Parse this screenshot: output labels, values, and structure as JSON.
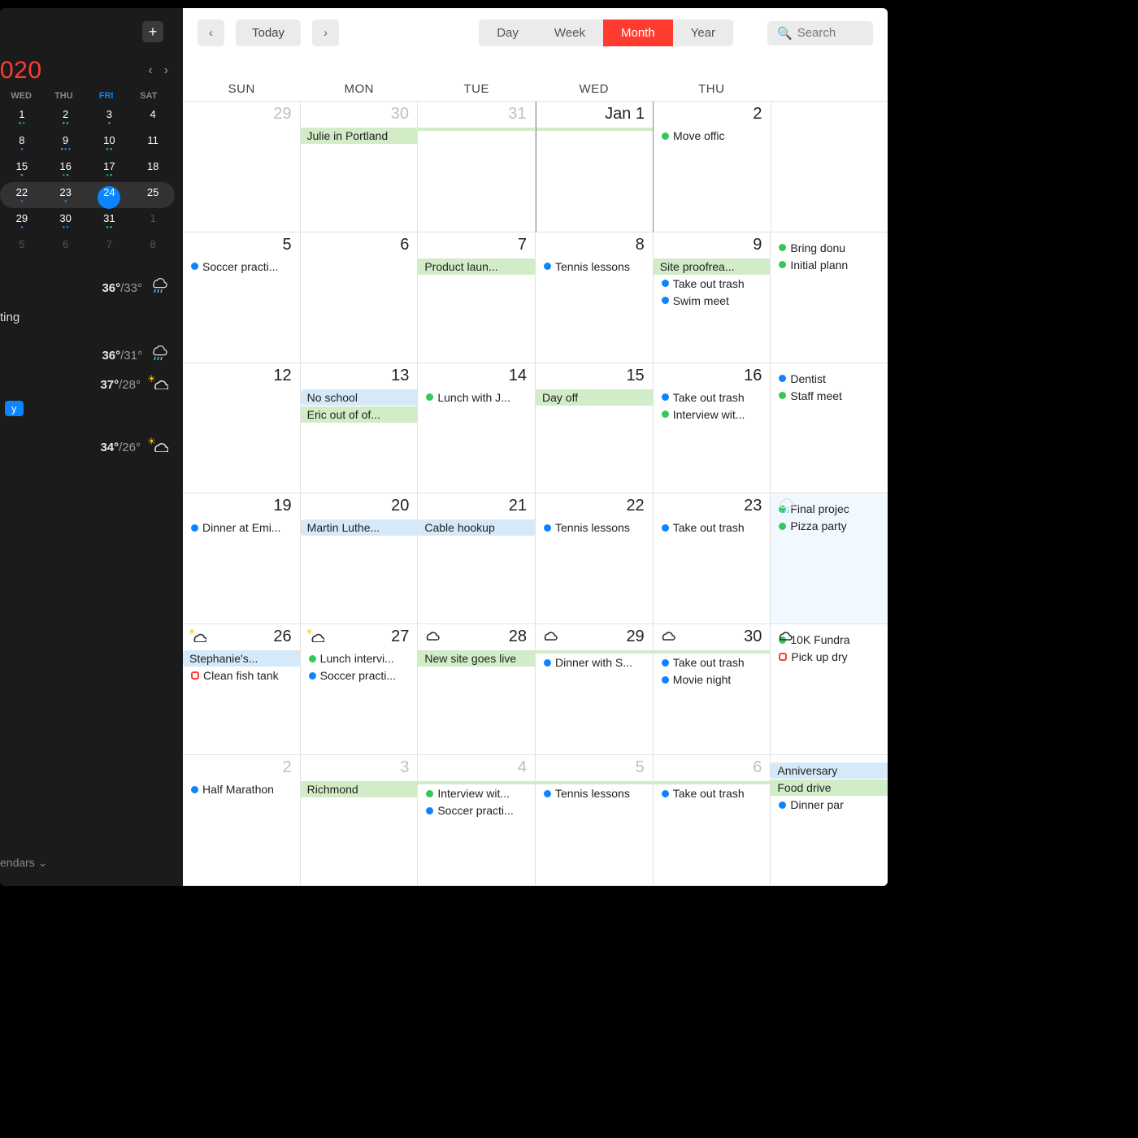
{
  "sidebar": {
    "year": "020",
    "mini_days_head": [
      "WED",
      "THU",
      "FRI",
      "SAT"
    ],
    "mini_grid": [
      [
        {
          "n": "1",
          "dots": [
            "g",
            "b"
          ]
        },
        {
          "n": "2",
          "dots": [
            "g",
            "g"
          ]
        },
        {
          "n": "3",
          "dots": [
            "g"
          ]
        },
        {
          "n": "4",
          "dots": []
        }
      ],
      [
        {
          "n": "8",
          "dots": [
            "b"
          ]
        },
        {
          "n": "9",
          "dots": [
            "g",
            "b",
            "b"
          ]
        },
        {
          "n": "10",
          "dots": [
            "g",
            "g"
          ]
        },
        {
          "n": "11",
          "dots": []
        }
      ],
      [
        {
          "n": "15",
          "dots": [
            "g"
          ]
        },
        {
          "n": "16",
          "dots": [
            "b",
            "g"
          ]
        },
        {
          "n": "17",
          "dots": [
            "b",
            "g"
          ]
        },
        {
          "n": "18",
          "dots": []
        }
      ],
      [
        {
          "n": "22",
          "dots": [
            "b"
          ]
        },
        {
          "n": "23",
          "dots": [
            "b"
          ]
        },
        {
          "n": "24",
          "dots": [
            "b",
            "b"
          ],
          "today": true
        },
        {
          "n": "25",
          "dots": []
        }
      ],
      [
        {
          "n": "29",
          "dots": [
            "b"
          ]
        },
        {
          "n": "30",
          "dots": [
            "b",
            "b"
          ]
        },
        {
          "n": "31",
          "dots": [
            "g",
            "g"
          ]
        },
        {
          "n": "1",
          "dots": [],
          "off": true
        }
      ],
      [
        {
          "n": "5",
          "dots": [],
          "off": true
        },
        {
          "n": "6",
          "dots": [],
          "off": true
        },
        {
          "n": "7",
          "dots": [],
          "off": true
        },
        {
          "n": "8",
          "dots": [],
          "off": true
        }
      ]
    ],
    "today_label": "ting",
    "pill": "y",
    "calendars_label": "endars",
    "weather": [
      {
        "hi": "36°",
        "lo": "/33°",
        "icon": "rain"
      },
      {
        "hi": "36°",
        "lo": "/31°",
        "icon": "rain"
      },
      {
        "hi": "37°",
        "lo": "/28°",
        "icon": "partly"
      },
      {
        "hi": "34°",
        "lo": "/26°",
        "icon": "partly"
      }
    ]
  },
  "toolbar": {
    "today": "Today",
    "views": [
      "Day",
      "Week",
      "Month",
      "Year"
    ],
    "active_view": "Month",
    "search_placeholder": "Search"
  },
  "day_heads": [
    "SUN",
    "MON",
    "TUE",
    "WED",
    "THU",
    ""
  ],
  "weeks": [
    {
      "cells": [
        {
          "num": "29",
          "off": true,
          "events": []
        },
        {
          "num": "30",
          "off": true,
          "events": [
            {
              "type": "bar-green",
              "text": "Julie in Portland"
            }
          ]
        },
        {
          "num": "31",
          "off": true,
          "events": [
            {
              "type": "bar-green",
              "text": ""
            }
          ]
        },
        {
          "num": "Jan 1",
          "events": [
            {
              "type": "bar-green",
              "text": ""
            }
          ],
          "today_col": true
        },
        {
          "num": "2",
          "events": [
            {
              "type": "dot",
              "color": "green",
              "text": "Move offic"
            }
          ]
        },
        {
          "num": "",
          "events": []
        }
      ]
    },
    {
      "cells": [
        {
          "num": "5",
          "events": [
            {
              "type": "dot",
              "color": "blue",
              "text": "Soccer practi..."
            }
          ]
        },
        {
          "num": "6",
          "events": []
        },
        {
          "num": "7",
          "events": [
            {
              "type": "bar-green",
              "text": "Product laun..."
            }
          ]
        },
        {
          "num": "8",
          "events": [
            {
              "type": "dot",
              "color": "blue",
              "text": "Tennis lessons"
            }
          ]
        },
        {
          "num": "9",
          "events": [
            {
              "type": "bar-green",
              "text": "Site proofrea..."
            },
            {
              "type": "dot",
              "color": "blue",
              "text": "Take out trash"
            },
            {
              "type": "dot",
              "color": "blue",
              "text": "Swim meet"
            }
          ]
        },
        {
          "num": "",
          "events": [
            {
              "type": "dot",
              "color": "green",
              "text": "Bring donu"
            },
            {
              "type": "dot",
              "color": "green",
              "text": "Initial plann"
            }
          ]
        }
      ]
    },
    {
      "cells": [
        {
          "num": "12",
          "events": []
        },
        {
          "num": "13",
          "events": [
            {
              "type": "bar-blue",
              "text": "No school"
            },
            {
              "type": "bar-green",
              "text": "Eric out of of..."
            }
          ]
        },
        {
          "num": "14",
          "events": [
            {
              "type": "dot",
              "color": "green",
              "text": "Lunch with J..."
            }
          ]
        },
        {
          "num": "15",
          "events": [
            {
              "type": "bar-green",
              "text": "Day off"
            }
          ]
        },
        {
          "num": "16",
          "events": [
            {
              "type": "dot",
              "color": "blue",
              "text": "Take out trash"
            },
            {
              "type": "dot",
              "color": "green",
              "text": "Interview wit..."
            }
          ]
        },
        {
          "num": "",
          "events": [
            {
              "type": "dot",
              "color": "blue",
              "text": "Dentist"
            },
            {
              "type": "dot",
              "color": "green",
              "text": "Staff meet"
            }
          ]
        }
      ]
    },
    {
      "cells": [
        {
          "num": "19",
          "events": [
            {
              "type": "dot",
              "color": "blue",
              "text": "Dinner at Emi..."
            }
          ]
        },
        {
          "num": "20",
          "events": [
            {
              "type": "bar-blue",
              "text": "Martin Luthe..."
            }
          ]
        },
        {
          "num": "21",
          "events": [
            {
              "type": "bar-blue",
              "text": "Cable hookup"
            }
          ]
        },
        {
          "num": "22",
          "events": [
            {
              "type": "dot",
              "color": "blue",
              "text": "Tennis lessons"
            }
          ]
        },
        {
          "num": "23",
          "events": [
            {
              "type": "dot",
              "color": "blue",
              "text": "Take out trash"
            }
          ]
        },
        {
          "num": "",
          "wx": "rain",
          "fri": true,
          "events": [
            {
              "type": "dot",
              "color": "green",
              "text": "Final projec"
            },
            {
              "type": "dot",
              "color": "green",
              "text": "Pizza party"
            }
          ]
        }
      ]
    },
    {
      "cells": [
        {
          "num": "26",
          "wx": "partly",
          "events": [
            {
              "type": "bar-blue",
              "text": "Stephanie's..."
            },
            {
              "type": "sq",
              "text": "Clean fish tank"
            }
          ]
        },
        {
          "num": "27",
          "wx": "partly",
          "events": [
            {
              "type": "dot",
              "color": "green",
              "text": "Lunch intervi..."
            },
            {
              "type": "dot",
              "color": "blue",
              "text": "Soccer practi..."
            }
          ]
        },
        {
          "num": "28",
          "wx": "cloud",
          "events": [
            {
              "type": "bar-green",
              "text": "New site goes live"
            }
          ]
        },
        {
          "num": "29",
          "wx": "cloud",
          "events": [
            {
              "type": "bar-green",
              "text": ""
            },
            {
              "type": "dot",
              "color": "blue",
              "text": "Dinner with S..."
            }
          ]
        },
        {
          "num": "30",
          "wx": "cloud",
          "events": [
            {
              "type": "bar-green",
              "text": ""
            },
            {
              "type": "dot",
              "color": "blue",
              "text": "Take out trash"
            },
            {
              "type": "dot",
              "color": "blue",
              "text": "Movie night"
            }
          ]
        },
        {
          "num": "",
          "wx": "cloud",
          "events": [
            {
              "type": "dot",
              "color": "green",
              "text": "10K Fundra"
            },
            {
              "type": "sq",
              "text": "Pick up dry"
            }
          ]
        }
      ]
    },
    {
      "cells": [
        {
          "num": "2",
          "off": true,
          "events": [
            {
              "type": "dot",
              "color": "blue",
              "text": "Half Marathon"
            }
          ]
        },
        {
          "num": "3",
          "off": true,
          "events": [
            {
              "type": "bar-green",
              "text": "Richmond"
            }
          ]
        },
        {
          "num": "4",
          "off": true,
          "events": [
            {
              "type": "bar-green",
              "text": ""
            },
            {
              "type": "dot",
              "color": "green",
              "text": "Interview wit..."
            },
            {
              "type": "dot",
              "color": "blue",
              "text": "Soccer practi..."
            }
          ]
        },
        {
          "num": "5",
          "off": true,
          "events": [
            {
              "type": "bar-green",
              "text": ""
            },
            {
              "type": "dot",
              "color": "blue",
              "text": "Tennis lessons"
            }
          ]
        },
        {
          "num": "6",
          "off": true,
          "events": [
            {
              "type": "bar-green",
              "text": ""
            },
            {
              "type": "dot",
              "color": "blue",
              "text": "Take out trash"
            }
          ]
        },
        {
          "num": "",
          "events": [
            {
              "type": "bar-blue",
              "text": "Anniversary"
            },
            {
              "type": "bar-green",
              "text": "Food drive"
            },
            {
              "type": "dot",
              "color": "blue",
              "text": "Dinner par"
            }
          ]
        }
      ]
    }
  ]
}
